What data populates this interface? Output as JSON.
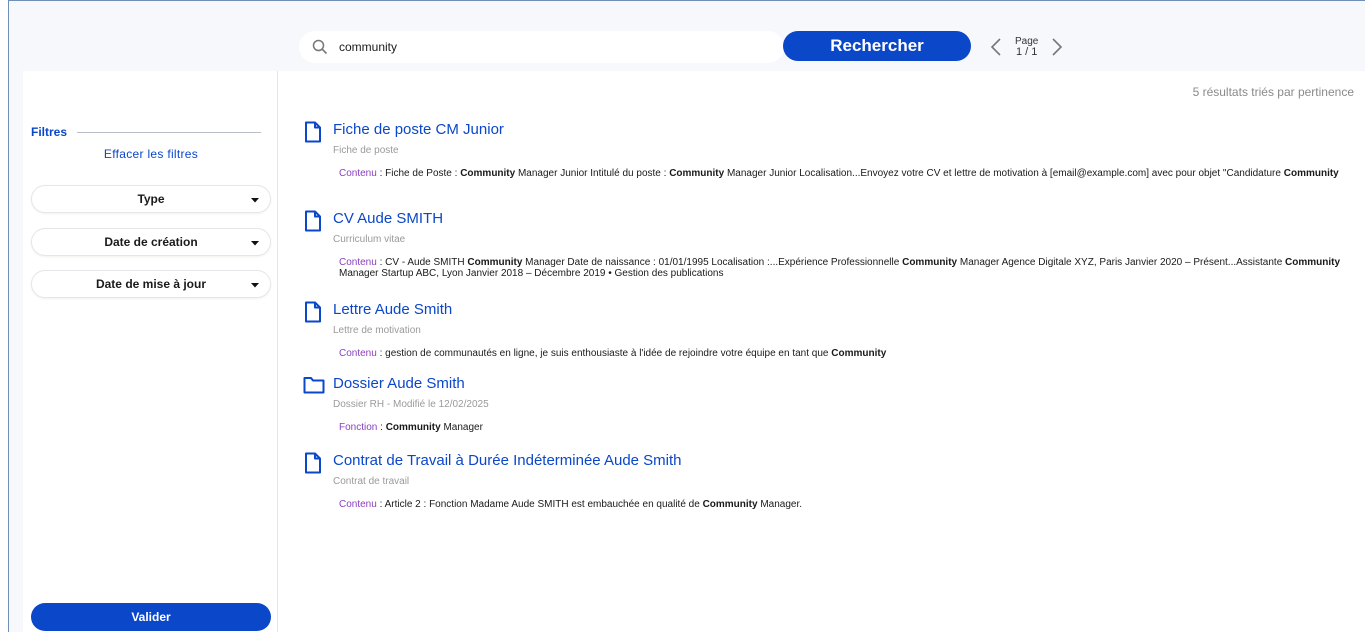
{
  "search": {
    "value": "community",
    "button_label": "Rechercher"
  },
  "pager": {
    "label": "Page",
    "current": "1 / 1"
  },
  "results_summary": "5 résultats triés par pertinence",
  "filters": {
    "title": "Filtres",
    "clear_label": "Effacer les filtres",
    "dropdowns": [
      "Type",
      "Date de création",
      "Date de mise à jour"
    ],
    "validate_label": "Valider"
  },
  "results": [
    {
      "icon": "file-icon",
      "title": "Fiche de poste CM Junior",
      "subtitle": "Fiche de poste",
      "snippet_label": "Contenu",
      "snippet_parts": [
        {
          "t": "Fiche de Poste : ",
          "b": false
        },
        {
          "t": "Community",
          "b": true
        },
        {
          "t": " Manager Junior Intitulé du poste : ",
          "b": false
        },
        {
          "t": "Community",
          "b": true
        },
        {
          "t": " Manager Junior Localisation...Envoyez votre CV et lettre de motivation à [email@example.com] avec pour objet \"Candidature ",
          "b": false
        },
        {
          "t": "Community",
          "b": true
        }
      ]
    },
    {
      "icon": "file-icon",
      "title": "CV Aude SMITH",
      "subtitle": "Curriculum vitae",
      "snippet_label": "Contenu",
      "snippet_parts": [
        {
          "t": "CV - Aude SMITH ",
          "b": false
        },
        {
          "t": "Community",
          "b": true
        },
        {
          "t": " Manager Date de naissance : 01/01/1995 Localisation :...Expérience Professionnelle ",
          "b": false
        },
        {
          "t": "Community",
          "b": true
        },
        {
          "t": " Manager Agence Digitale XYZ, Paris Janvier 2020 – Présent...Assistante ",
          "b": false
        },
        {
          "t": "Community",
          "b": true
        },
        {
          "t": " Manager Startup ABC, Lyon Janvier 2018 – Décembre 2019 • Gestion des publications",
          "b": false
        }
      ]
    },
    {
      "icon": "file-icon",
      "title": "Lettre Aude Smith",
      "subtitle": "Lettre de motivation",
      "snippet_label": "Contenu",
      "snippet_parts": [
        {
          "t": "gestion de communautés en ligne, je suis enthousiaste à l'idée de rejoindre votre équipe en tant que ",
          "b": false
        },
        {
          "t": "Community",
          "b": true
        }
      ]
    },
    {
      "icon": "folder-icon",
      "title": "Dossier Aude Smith",
      "subtitle": "Dossier RH - Modifié le 12/02/2025",
      "snippet_label": "Fonction",
      "snippet_parts": [
        {
          "t": "Community",
          "b": true
        },
        {
          "t": " Manager",
          "b": false
        }
      ]
    },
    {
      "icon": "file-icon",
      "title": "Contrat de Travail à Durée Indéterminée Aude Smith",
      "subtitle": "Contrat de travail",
      "snippet_label": "Contenu",
      "snippet_parts": [
        {
          "t": "Article 2 : Fonction Madame Aude SMITH est embauchée en qualité de ",
          "b": false
        },
        {
          "t": "Community",
          "b": true
        },
        {
          "t": " Manager.",
          "b": false
        }
      ]
    }
  ],
  "colors": {
    "accent": "#0b47c9",
    "label": "#8a3fbf",
    "muted": "#9a9a9a"
  }
}
